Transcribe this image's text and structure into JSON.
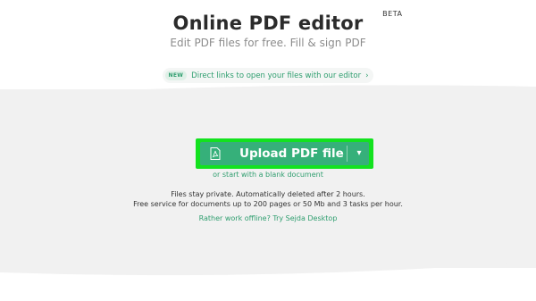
{
  "header": {
    "title": "Online PDF editor",
    "beta": "BETA",
    "subtitle": "Edit PDF files for free. Fill & sign PDF"
  },
  "news": {
    "badge": "NEW",
    "text": "Direct links to open your files with our editor",
    "chevron": "›"
  },
  "upload": {
    "label": "Upload PDF file",
    "dropdown_arrow": "▾",
    "icon": "pdf-file-icon"
  },
  "blank_link": "or start with a blank document",
  "info": {
    "line1": "Files stay private. Automatically deleted after 2 hours.",
    "line2": "Free service for documents up to 200 pages or 50 Mb and 3 tasks per hour."
  },
  "offline_link": "Rather work offline? Try Sejda Desktop",
  "colors": {
    "accent": "#36b07a",
    "highlight": "#13e21f",
    "background_band": "#f1f1f1"
  }
}
